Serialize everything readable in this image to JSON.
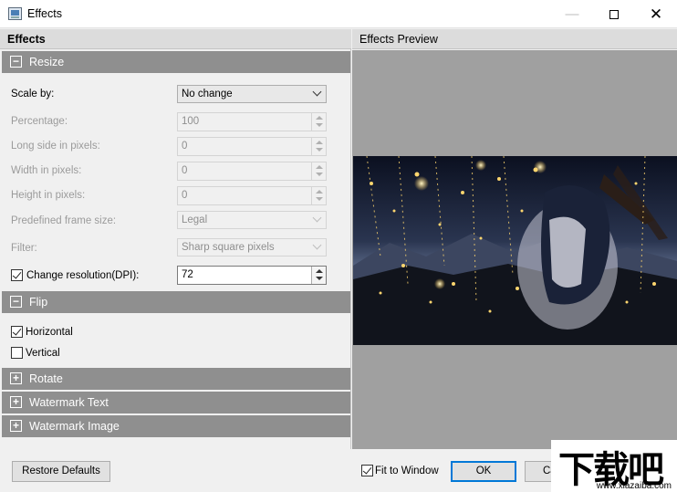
{
  "window": {
    "title": "Effects"
  },
  "left_panel": {
    "header": "Effects",
    "resize": {
      "title": "Resize",
      "scale_by": {
        "label": "Scale by:",
        "value": "No change"
      },
      "percentage": {
        "label": "Percentage:",
        "value": "100"
      },
      "long_side": {
        "label": "Long side in pixels:",
        "value": "0"
      },
      "width": {
        "label": "Width in pixels:",
        "value": "0"
      },
      "height": {
        "label": "Height in pixels:",
        "value": "0"
      },
      "frame_size": {
        "label": "Predefined frame size:",
        "value": "Legal"
      },
      "filter": {
        "label": "Filter:",
        "value": "Sharp square pixels"
      },
      "change_resolution": {
        "label": "Change resolution(DPI):",
        "checked": true,
        "value": "72"
      }
    },
    "flip": {
      "title": "Flip",
      "horizontal": {
        "label": "Horizontal",
        "checked": true
      },
      "vertical": {
        "label": "Vertical",
        "checked": false
      }
    },
    "rotate": {
      "title": "Rotate"
    },
    "watermark_text": {
      "title": "Watermark Text"
    },
    "watermark_image": {
      "title": "Watermark Image"
    }
  },
  "right_panel": {
    "header": "Effects Preview"
  },
  "footer": {
    "restore_defaults": "Restore Defaults",
    "fit_to_window": {
      "label": "Fit to Window",
      "checked": true
    },
    "ok": "OK",
    "cancel": "Ca"
  },
  "watermark": {
    "main": "下载吧",
    "sub": "www.xiazaiba.com"
  }
}
